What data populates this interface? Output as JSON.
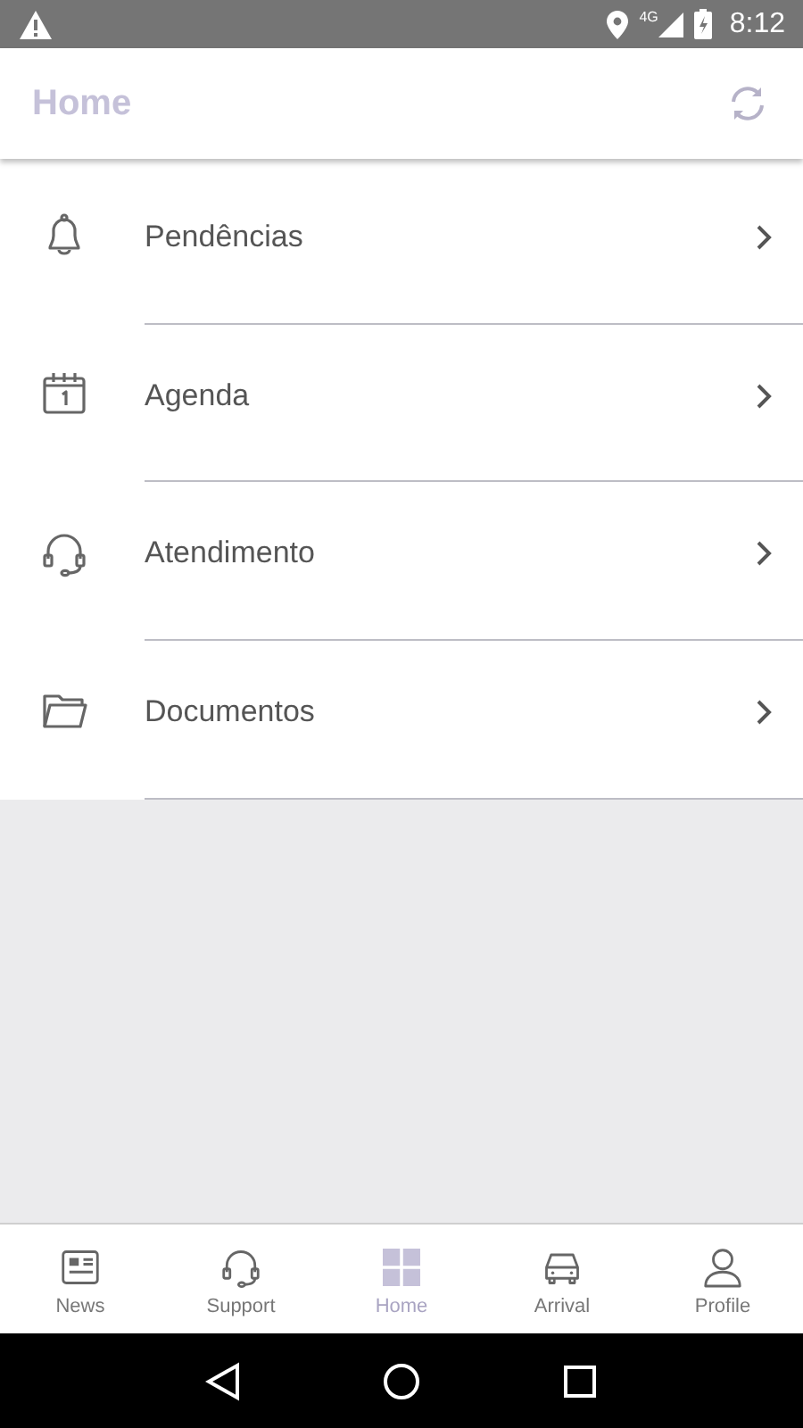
{
  "status_bar": {
    "network": "4G",
    "time": "8:12"
  },
  "header": {
    "title": "Home"
  },
  "menu": [
    {
      "label": "Pendências",
      "kind": "bell"
    },
    {
      "label": "Agenda",
      "kind": "calendar"
    },
    {
      "label": "Atendimento",
      "kind": "headset"
    },
    {
      "label": "Documentos",
      "kind": "folder"
    }
  ],
  "tabs": [
    {
      "label": "News",
      "kind": "news",
      "selected": false
    },
    {
      "label": "Support",
      "kind": "headset",
      "selected": false
    },
    {
      "label": "Home",
      "kind": "grid",
      "selected": true
    },
    {
      "label": "Arrival",
      "kind": "car",
      "selected": false
    },
    {
      "label": "Profile",
      "kind": "person",
      "selected": false
    }
  ]
}
